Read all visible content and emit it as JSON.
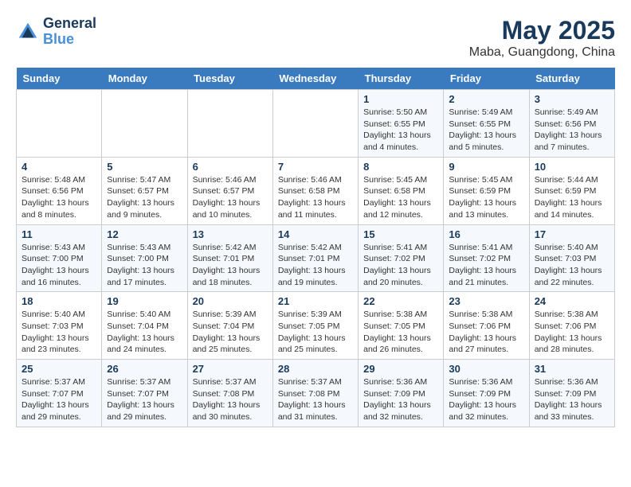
{
  "header": {
    "logo_line1": "General",
    "logo_line2": "Blue",
    "month_year": "May 2025",
    "location": "Maba, Guangdong, China"
  },
  "days_of_week": [
    "Sunday",
    "Monday",
    "Tuesday",
    "Wednesday",
    "Thursday",
    "Friday",
    "Saturday"
  ],
  "weeks": [
    [
      {
        "day": "",
        "info": ""
      },
      {
        "day": "",
        "info": ""
      },
      {
        "day": "",
        "info": ""
      },
      {
        "day": "",
        "info": ""
      },
      {
        "day": "1",
        "info": "Sunrise: 5:50 AM\nSunset: 6:55 PM\nDaylight: 13 hours\nand 4 minutes."
      },
      {
        "day": "2",
        "info": "Sunrise: 5:49 AM\nSunset: 6:55 PM\nDaylight: 13 hours\nand 5 minutes."
      },
      {
        "day": "3",
        "info": "Sunrise: 5:49 AM\nSunset: 6:56 PM\nDaylight: 13 hours\nand 7 minutes."
      }
    ],
    [
      {
        "day": "4",
        "info": "Sunrise: 5:48 AM\nSunset: 6:56 PM\nDaylight: 13 hours\nand 8 minutes."
      },
      {
        "day": "5",
        "info": "Sunrise: 5:47 AM\nSunset: 6:57 PM\nDaylight: 13 hours\nand 9 minutes."
      },
      {
        "day": "6",
        "info": "Sunrise: 5:46 AM\nSunset: 6:57 PM\nDaylight: 13 hours\nand 10 minutes."
      },
      {
        "day": "7",
        "info": "Sunrise: 5:46 AM\nSunset: 6:58 PM\nDaylight: 13 hours\nand 11 minutes."
      },
      {
        "day": "8",
        "info": "Sunrise: 5:45 AM\nSunset: 6:58 PM\nDaylight: 13 hours\nand 12 minutes."
      },
      {
        "day": "9",
        "info": "Sunrise: 5:45 AM\nSunset: 6:59 PM\nDaylight: 13 hours\nand 13 minutes."
      },
      {
        "day": "10",
        "info": "Sunrise: 5:44 AM\nSunset: 6:59 PM\nDaylight: 13 hours\nand 14 minutes."
      }
    ],
    [
      {
        "day": "11",
        "info": "Sunrise: 5:43 AM\nSunset: 7:00 PM\nDaylight: 13 hours\nand 16 minutes."
      },
      {
        "day": "12",
        "info": "Sunrise: 5:43 AM\nSunset: 7:00 PM\nDaylight: 13 hours\nand 17 minutes."
      },
      {
        "day": "13",
        "info": "Sunrise: 5:42 AM\nSunset: 7:01 PM\nDaylight: 13 hours\nand 18 minutes."
      },
      {
        "day": "14",
        "info": "Sunrise: 5:42 AM\nSunset: 7:01 PM\nDaylight: 13 hours\nand 19 minutes."
      },
      {
        "day": "15",
        "info": "Sunrise: 5:41 AM\nSunset: 7:02 PM\nDaylight: 13 hours\nand 20 minutes."
      },
      {
        "day": "16",
        "info": "Sunrise: 5:41 AM\nSunset: 7:02 PM\nDaylight: 13 hours\nand 21 minutes."
      },
      {
        "day": "17",
        "info": "Sunrise: 5:40 AM\nSunset: 7:03 PM\nDaylight: 13 hours\nand 22 minutes."
      }
    ],
    [
      {
        "day": "18",
        "info": "Sunrise: 5:40 AM\nSunset: 7:03 PM\nDaylight: 13 hours\nand 23 minutes."
      },
      {
        "day": "19",
        "info": "Sunrise: 5:40 AM\nSunset: 7:04 PM\nDaylight: 13 hours\nand 24 minutes."
      },
      {
        "day": "20",
        "info": "Sunrise: 5:39 AM\nSunset: 7:04 PM\nDaylight: 13 hours\nand 25 minutes."
      },
      {
        "day": "21",
        "info": "Sunrise: 5:39 AM\nSunset: 7:05 PM\nDaylight: 13 hours\nand 25 minutes."
      },
      {
        "day": "22",
        "info": "Sunrise: 5:38 AM\nSunset: 7:05 PM\nDaylight: 13 hours\nand 26 minutes."
      },
      {
        "day": "23",
        "info": "Sunrise: 5:38 AM\nSunset: 7:06 PM\nDaylight: 13 hours\nand 27 minutes."
      },
      {
        "day": "24",
        "info": "Sunrise: 5:38 AM\nSunset: 7:06 PM\nDaylight: 13 hours\nand 28 minutes."
      }
    ],
    [
      {
        "day": "25",
        "info": "Sunrise: 5:37 AM\nSunset: 7:07 PM\nDaylight: 13 hours\nand 29 minutes."
      },
      {
        "day": "26",
        "info": "Sunrise: 5:37 AM\nSunset: 7:07 PM\nDaylight: 13 hours\nand 29 minutes."
      },
      {
        "day": "27",
        "info": "Sunrise: 5:37 AM\nSunset: 7:08 PM\nDaylight: 13 hours\nand 30 minutes."
      },
      {
        "day": "28",
        "info": "Sunrise: 5:37 AM\nSunset: 7:08 PM\nDaylight: 13 hours\nand 31 minutes."
      },
      {
        "day": "29",
        "info": "Sunrise: 5:36 AM\nSunset: 7:09 PM\nDaylight: 13 hours\nand 32 minutes."
      },
      {
        "day": "30",
        "info": "Sunrise: 5:36 AM\nSunset: 7:09 PM\nDaylight: 13 hours\nand 32 minutes."
      },
      {
        "day": "31",
        "info": "Sunrise: 5:36 AM\nSunset: 7:09 PM\nDaylight: 13 hours\nand 33 minutes."
      }
    ]
  ]
}
